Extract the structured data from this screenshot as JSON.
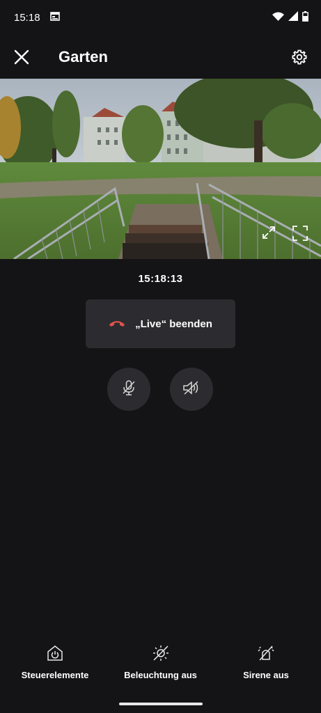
{
  "status": {
    "time": "15:18"
  },
  "header": {
    "title": "Garten"
  },
  "video": {
    "timestamp": "15:18:13"
  },
  "live": {
    "end_label": "„Live“ beenden"
  },
  "bottom": {
    "controls_label": "Steuerelemente",
    "light_label": "Beleuchtung aus",
    "siren_label": "Sirene aus"
  },
  "colors": {
    "background": "#141416",
    "button": "#2c2c30",
    "hangup": "#e0544a"
  }
}
